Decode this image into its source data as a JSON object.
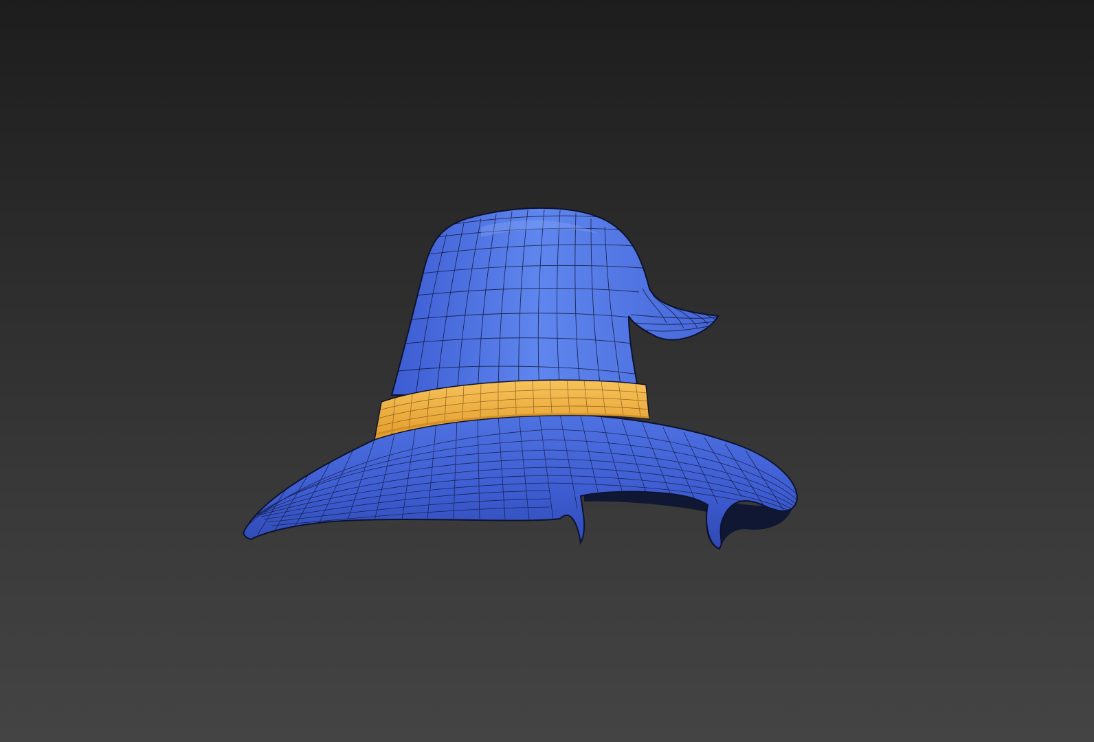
{
  "scene": {
    "subject": "wizard-hat-wireframe-model",
    "colors": {
      "background_top": "#1d1d1d",
      "background_bottom": "#444444",
      "hat_body": "#4a6fe0",
      "hat_highlight": "#6e92f2",
      "hat_shadow": "#2e48b5",
      "band": "#f4b23e",
      "band_shadow": "#c7861e",
      "wire": "#0d1230",
      "inner_dark": "#0f1733"
    }
  }
}
